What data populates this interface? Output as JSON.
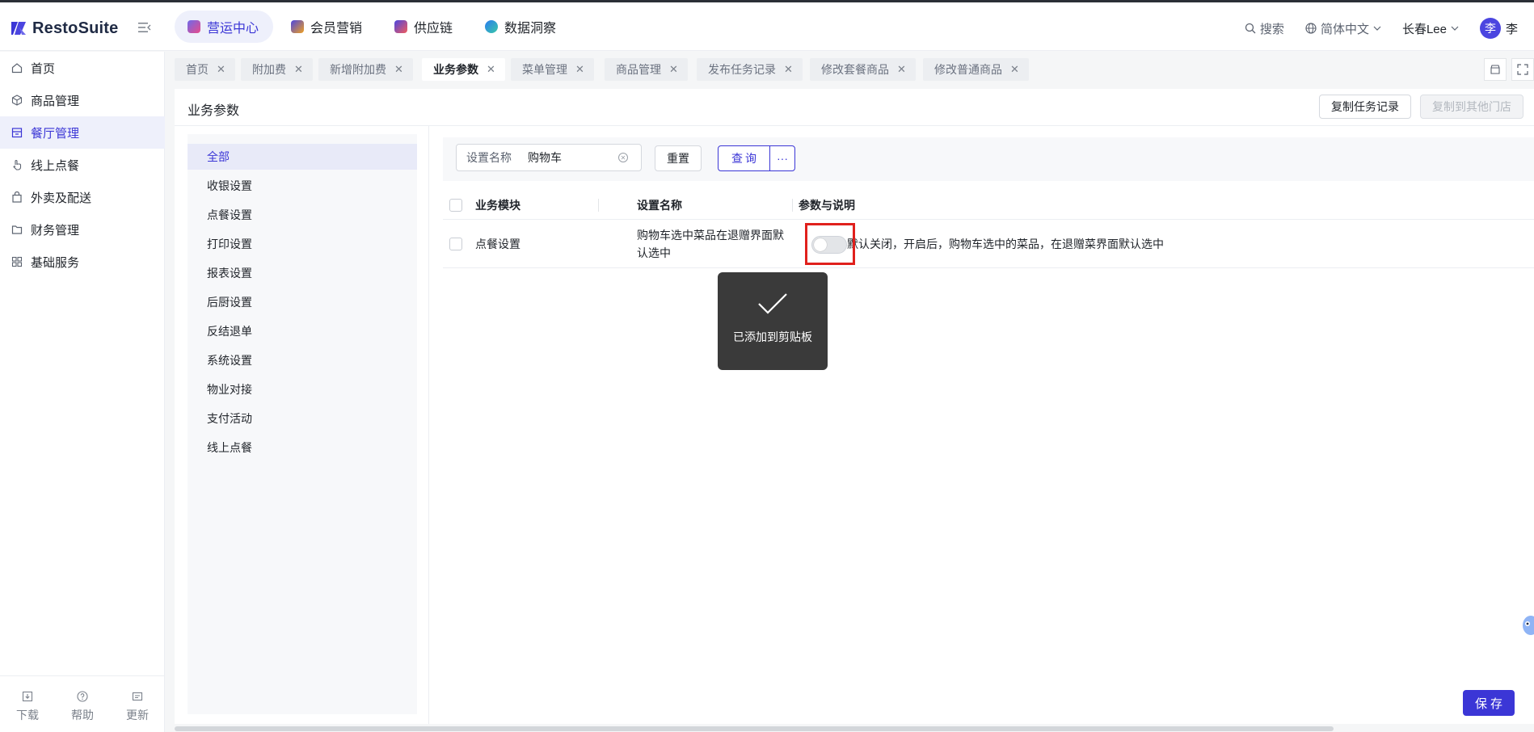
{
  "app": {
    "name": "RestoSuite"
  },
  "topnav": [
    {
      "label": "营运中心",
      "color": "#4b45e0"
    },
    {
      "label": "会员营销",
      "color": "#f0a020"
    },
    {
      "label": "供应链",
      "color": "#4b45e0"
    },
    {
      "label": "数据洞察",
      "color": "#2a7bf0"
    }
  ],
  "header": {
    "search": "搜索",
    "language": "简体中文",
    "store": "长春Lee",
    "avatar_char": "李",
    "user": "李"
  },
  "sidebar": {
    "items": [
      {
        "label": "首页",
        "icon": "home-icon"
      },
      {
        "label": "商品管理",
        "icon": "cube-icon"
      },
      {
        "label": "餐厅管理",
        "icon": "store-icon"
      },
      {
        "label": "线上点餐",
        "icon": "tap-icon"
      },
      {
        "label": "外卖及配送",
        "icon": "bag-icon"
      },
      {
        "label": "财务管理",
        "icon": "folder-icon"
      },
      {
        "label": "基础服务",
        "icon": "grid-icon"
      }
    ],
    "footer": [
      {
        "label": "下载",
        "icon": "download-icon"
      },
      {
        "label": "帮助",
        "icon": "help-icon"
      },
      {
        "label": "更新",
        "icon": "update-icon"
      }
    ]
  },
  "tabs": [
    "首页",
    "附加费",
    "新增附加费",
    "业务参数",
    "菜单管理",
    "商品管理",
    "发布任务记录",
    "修改套餐商品",
    "修改普通商品"
  ],
  "page": {
    "title": "业务参数",
    "copy_task_button": "复制任务记录",
    "copy_to_store_button": "复制到其他门店"
  },
  "categories": [
    "全部",
    "收银设置",
    "点餐设置",
    "打印设置",
    "报表设置",
    "后厨设置",
    "反结退单",
    "系统设置",
    "物业对接",
    "支付活动",
    "线上点餐"
  ],
  "filter": {
    "label": "设置名称",
    "value": "购物车",
    "reset": "重置",
    "query": "查询",
    "more": "···"
  },
  "table": {
    "headers": [
      "业务模块",
      "设置名称",
      "参数与说明"
    ],
    "rows": [
      {
        "module": "点餐设置",
        "setting": "购物车选中菜品在退赠界面默认选中",
        "enabled": false,
        "description": "默认关闭，开启后，购物车选中的菜品，在退赠菜界面默认选中"
      }
    ]
  },
  "toast": {
    "text": "已添加到剪贴板"
  },
  "save_button": "保存",
  "colors": {
    "accent": "#3b36d6",
    "highlight": "#e0201c",
    "toast_bg": "#3a3a3a"
  }
}
